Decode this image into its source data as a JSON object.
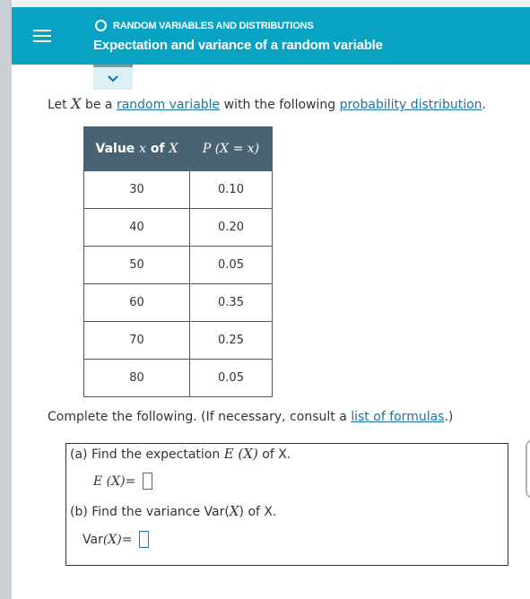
{
  "header": {
    "breadcrumb": "RANDOM VARIABLES AND DISTRIBUTIONS",
    "title": "Expectation and variance of a random variable"
  },
  "intro": {
    "prefix": "Let ",
    "variable": "X",
    "middle": " be a ",
    "link1": "random variable",
    "middle2": " with the following ",
    "link2": "probability distribution",
    "suffix": "."
  },
  "table": {
    "col1_header_text": "Value ",
    "col1_header_x": "x",
    "col1_header_of": " of ",
    "col1_header_X": "X",
    "col2_header": "P (X = x)",
    "rows": [
      {
        "x": "30",
        "p": "0.10"
      },
      {
        "x": "40",
        "p": "0.20"
      },
      {
        "x": "50",
        "p": "0.05"
      },
      {
        "x": "60",
        "p": "0.35"
      },
      {
        "x": "70",
        "p": "0.25"
      },
      {
        "x": "80",
        "p": "0.05"
      }
    ]
  },
  "instructions": {
    "text": "Complete the following. (If necessary, consult a ",
    "link": "list of formulas",
    "suffix": ".)"
  },
  "part_a": {
    "question": "(a) Find the expectation ",
    "expr": "E (X)",
    "question_suffix": " of X.",
    "lhs": "E (X)",
    "eq": " = "
  },
  "part_b": {
    "question": "(b) Find the variance Var(",
    "var": "X",
    "question_suffix": ") of X.",
    "lhs_text": "Var",
    "lhs_arg": "(X)",
    "eq": " = "
  },
  "colors": {
    "header_bg": "#0aa2c2",
    "table_header_bg": "#4a6373",
    "link": "#1a73a8",
    "input_border": "#2b6fb0"
  },
  "icons": [
    "menu-icon",
    "ring-icon",
    "chevron-down-icon"
  ]
}
